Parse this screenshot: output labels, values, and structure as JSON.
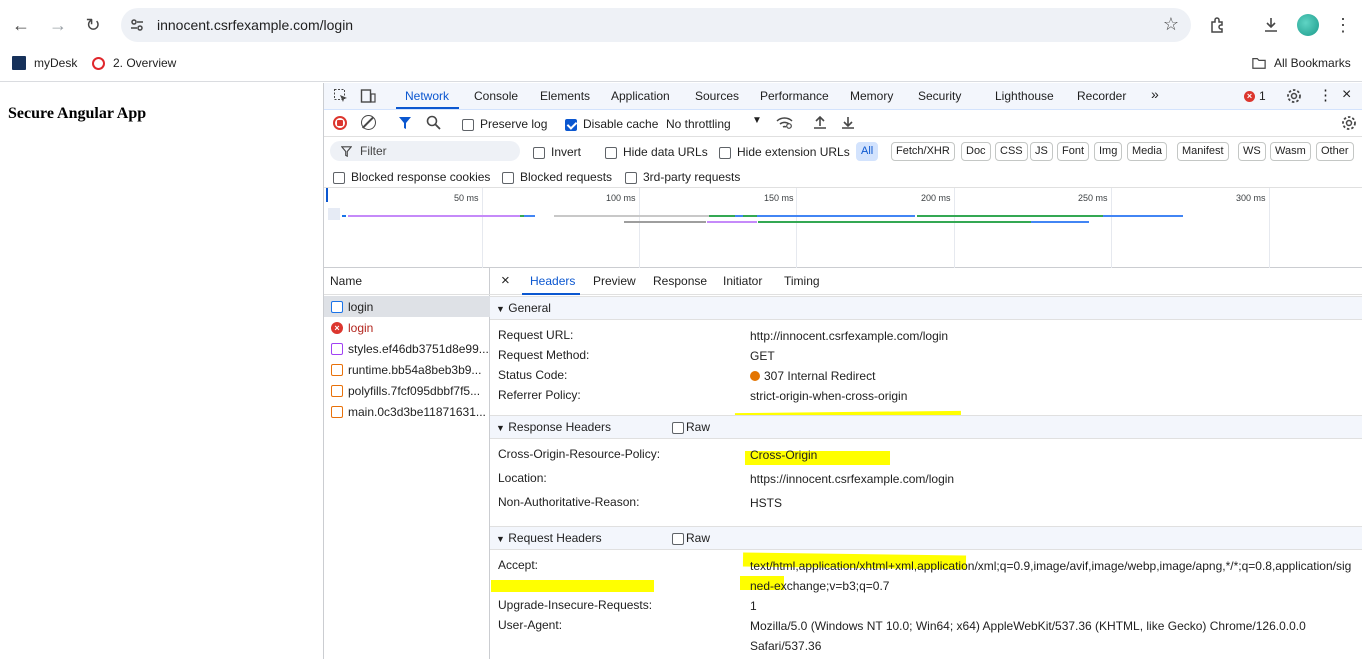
{
  "browser": {
    "url": "innocent.csrfexample.com/login",
    "bookmarks": [
      {
        "label": "myDesk",
        "icon": "morgan-stanley-logo-icon"
      },
      {
        "label": "2. Overview",
        "icon": "opera-o-icon"
      }
    ],
    "all_bookmarks": "All Bookmarks"
  },
  "page": {
    "heading": "Secure Angular App"
  },
  "devtools": {
    "tabs": [
      "Network",
      "Console",
      "Elements",
      "Application",
      "Sources",
      "Performance",
      "Memory",
      "Security",
      "Lighthouse",
      "Recorder"
    ],
    "error_count": "1",
    "network_bar": {
      "preserve_log": "Preserve log",
      "disable_cache": "Disable cache",
      "throttling": "No throttling"
    },
    "filter": {
      "placeholder": "Filter",
      "invert": "Invert",
      "hide_data_urls": "Hide data URLs",
      "hide_extension_urls": "Hide extension URLs",
      "types": [
        "All",
        "Fetch/XHR",
        "Doc",
        "CSS",
        "JS",
        "Font",
        "Img",
        "Media",
        "Manifest",
        "WS",
        "Wasm",
        "Other"
      ]
    },
    "blocked": {
      "response_cookies": "Blocked response cookies",
      "requests": "Blocked requests",
      "third_party": "3rd-party requests"
    },
    "timeline_ticks": [
      "50 ms",
      "100 ms",
      "150 ms",
      "200 ms",
      "250 ms",
      "300 ms"
    ],
    "list_header": "Name",
    "requests": [
      {
        "name": "login",
        "type": "doc",
        "error": false,
        "selected": true
      },
      {
        "name": "login",
        "type": "error",
        "error": true,
        "selected": false
      },
      {
        "name": "styles.ef46db3751d8e99...",
        "type": "css",
        "error": false,
        "selected": false
      },
      {
        "name": "runtime.bb54a8beb3b9...",
        "type": "js",
        "error": false,
        "selected": false
      },
      {
        "name": "polyfills.7fcf095dbbf7f5...",
        "type": "js",
        "error": false,
        "selected": false
      },
      {
        "name": "main.0c3d3be11871631...",
        "type": "js",
        "error": false,
        "selected": false
      }
    ],
    "detail_tabs": [
      "Headers",
      "Preview",
      "Response",
      "Initiator",
      "Timing"
    ],
    "general": {
      "title": "General",
      "rows": [
        {
          "key": "Request URL:",
          "value": "http://innocent.csrfexample.com/login"
        },
        {
          "key": "Request Method:",
          "value": "GET"
        },
        {
          "key": "Status Code:",
          "value": "307 Internal Redirect"
        },
        {
          "key": "Referrer Policy:",
          "value": "strict-origin-when-cross-origin"
        }
      ]
    },
    "response_headers": {
      "title": "Response Headers",
      "raw": "Raw",
      "rows": [
        {
          "key": "Cross-Origin-Resource-Policy:",
          "value": "Cross-Origin"
        },
        {
          "key": "Location:",
          "value": "https://innocent.csrfexample.com/login"
        },
        {
          "key": "Non-Authoritative-Reason:",
          "value": "HSTS"
        }
      ]
    },
    "request_headers": {
      "title": "Request Headers",
      "raw": "Raw",
      "rows": [
        {
          "key": "Accept:",
          "value": "text/html,application/xhtml+xml,application/xml;q=0.9,image/avif,image/webp,image/apng,*/*;q=0.8,application/signed-exchange;v=b3;q=0.7"
        },
        {
          "key": "Upgrade-Insecure-Requests:",
          "value": "1"
        },
        {
          "key": "User-Agent:",
          "value": "Mozilla/5.0 (Windows NT 10.0; Win64; x64) AppleWebKit/537.36 (KHTML, like Gecko) Chrome/126.0.0.0 Safari/537.36"
        }
      ]
    },
    "colors": {
      "accent": "#0b57d0",
      "highlight": "#ffff00",
      "status_warning": "#e37400",
      "error": "#b3261e"
    }
  }
}
